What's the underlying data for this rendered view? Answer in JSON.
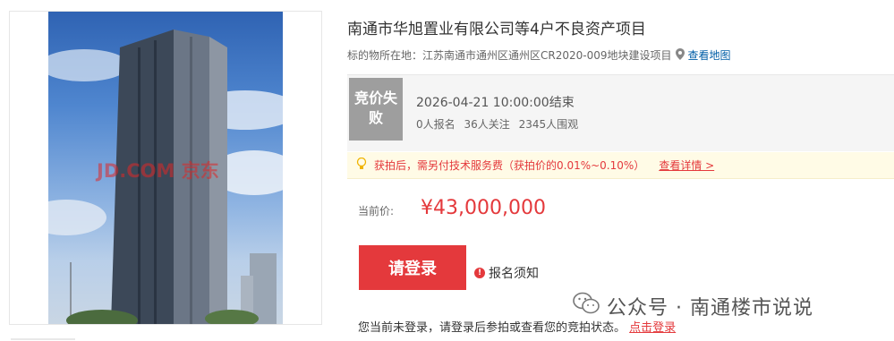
{
  "item": {
    "title": "南通市华旭置业有限公司等4户不良资产项目",
    "location_prefix": "标的物所在地：",
    "location": "江苏南通市通州区通州区CR2020-009地块建设项目",
    "map_link": "查看地图"
  },
  "image": {
    "watermark": "JD.COM 京东"
  },
  "status": {
    "badge": "竞价失败",
    "end_time": "2026-04-21 10:00:00结束",
    "signups": "0人报名",
    "followers": "36人关注",
    "viewers": "2345人围观"
  },
  "notice": {
    "text": "获拍后，需另付技术服务费（获拍价的0.01%~0.10%）",
    "detail_link": "查看详情 >"
  },
  "price": {
    "label": "当前价:",
    "value": "¥43,000,000"
  },
  "actions": {
    "login_button": "请登录",
    "registration_notice": "报名须知"
  },
  "login_hint": {
    "text": "您当前未登录，请登录后参拍或查看您的竞拍状态。",
    "link": "点击登录"
  },
  "overlay": {
    "wechat_text": "公众号 · 南通楼市说说"
  },
  "colors": {
    "accent": "#e4393c",
    "link": "#005ea7",
    "badge_gray": "#9e9e9e",
    "notice_bg": "#fffbe6"
  }
}
